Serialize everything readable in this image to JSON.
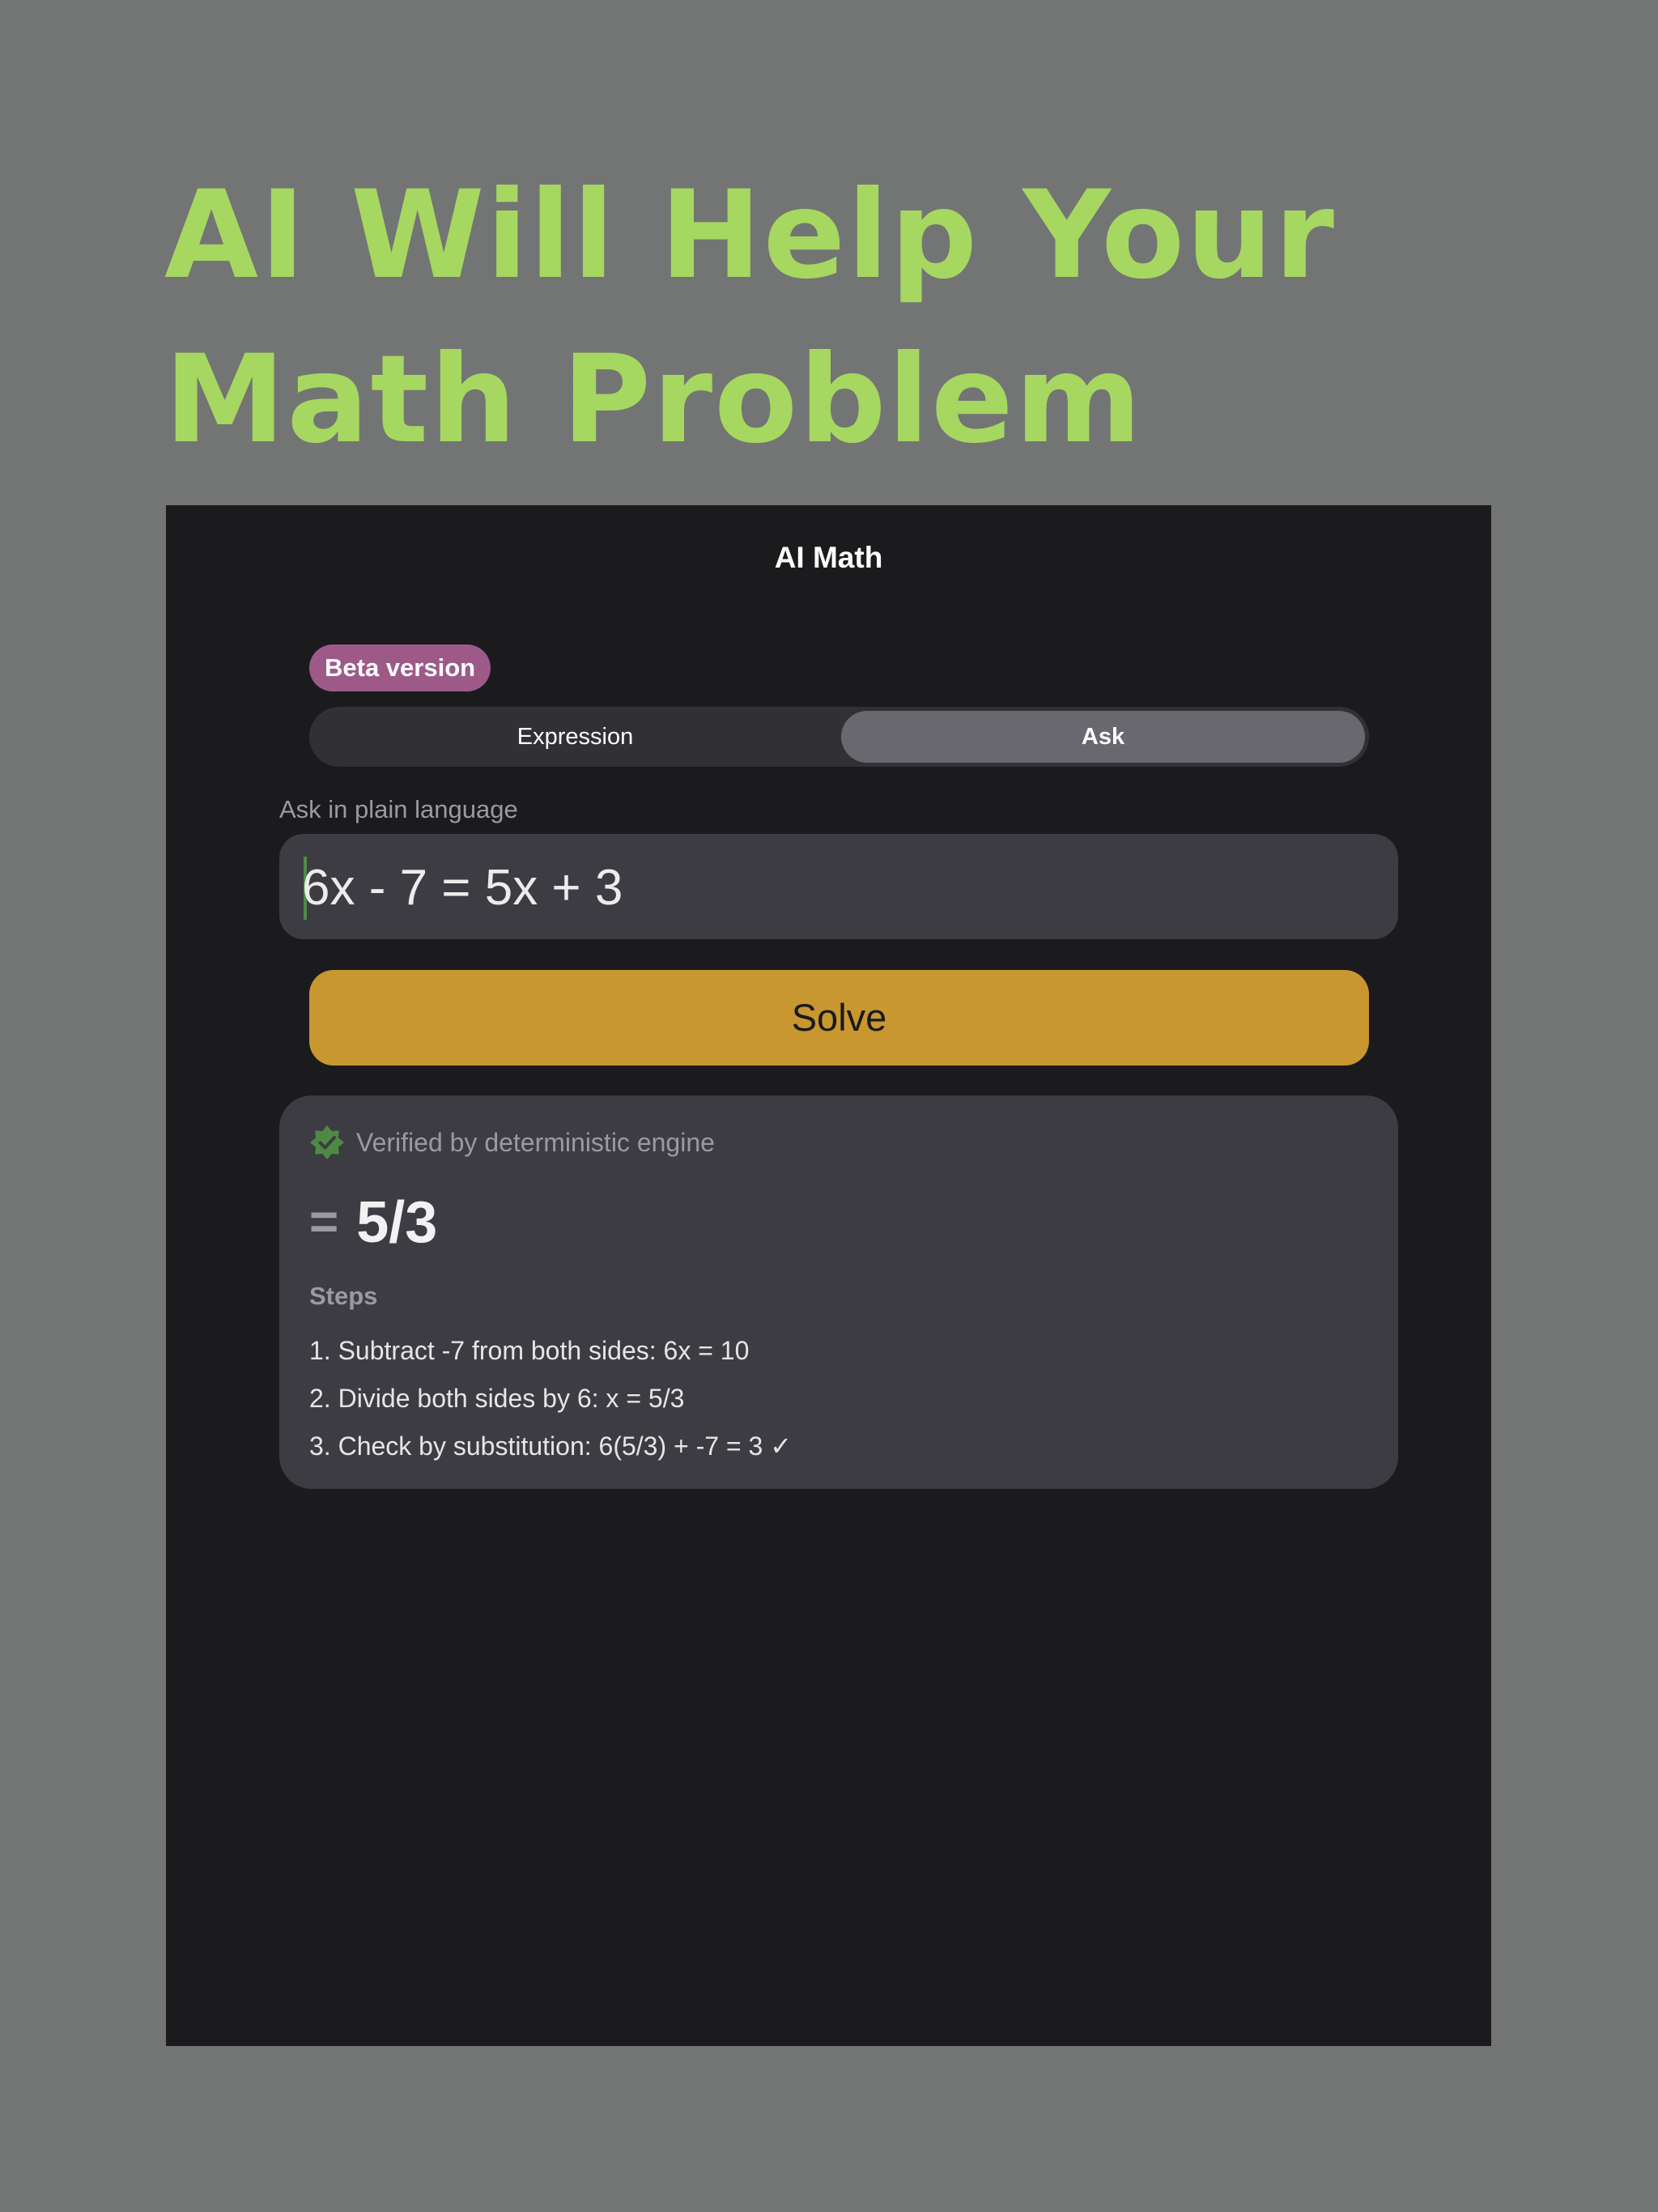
{
  "headline": {
    "line1": "AI Will Help Your",
    "line2": "Math Problem"
  },
  "app": {
    "title": "AI Math",
    "badge": "Beta version",
    "mode_tabs": [
      {
        "label": "Expression",
        "selected": false
      },
      {
        "label": "Ask",
        "selected": true
      }
    ],
    "input": {
      "label": "Ask in plain language",
      "value": "6x - 7 = 5x + 3"
    },
    "solve_label": "Solve",
    "result": {
      "verified_text": "Verified by deterministic engine",
      "equals_sign": "=",
      "answer": "5/3",
      "steps_heading": "Steps",
      "steps": [
        "1. Subtract -7 from both sides: 6x = 10",
        "2. Divide both sides by 6: x = 5/3",
        "3. Check by substitution: 6(5/3) + -7 = 3 ✓"
      ]
    }
  },
  "colors": {
    "page_background": "#737574",
    "headline": "#a6d760",
    "app_background": "#1b1b1d",
    "badge": "#9d5a89",
    "solve_button": "#c99730",
    "verified_icon": "#4f8a45"
  }
}
